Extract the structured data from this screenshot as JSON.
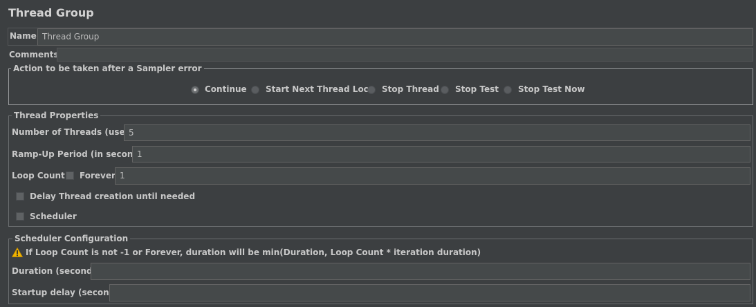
{
  "title": "Thread Group",
  "name": {
    "label": "Name:",
    "value": "Thread Group"
  },
  "comments": {
    "label": "Comments:",
    "value": ""
  },
  "sampler_error": {
    "legend": "Action to be taken after a Sampler error",
    "selected": "Continue",
    "options": [
      "Continue",
      "Start Next Thread Loop",
      "Stop Thread",
      "Stop Test",
      "Stop Test Now"
    ]
  },
  "thread_properties": {
    "legend": "Thread Properties",
    "threads_label": "Number of Threads (users):",
    "threads_value": "5",
    "rampup_label": "Ramp-Up Period (in seconds):",
    "rampup_value": "1",
    "loop_label": "Loop Count:",
    "forever_label": "Forever",
    "forever_checked": false,
    "loop_value": "1",
    "delay_label": "Delay Thread creation until needed",
    "delay_checked": false,
    "scheduler_label": "Scheduler",
    "scheduler_checked": false
  },
  "scheduler_config": {
    "legend": "Scheduler Configuration",
    "warning": "If Loop Count is not -1 or Forever, duration will be min(Duration, Loop Count * iteration duration)",
    "duration_label": "Duration (seconds)",
    "duration_value": "",
    "startup_label": "Startup delay (seconds)",
    "startup_value": ""
  },
  "colors": {
    "background": "#3c3f41",
    "field": "#45494a",
    "warning": "#f0b400"
  }
}
